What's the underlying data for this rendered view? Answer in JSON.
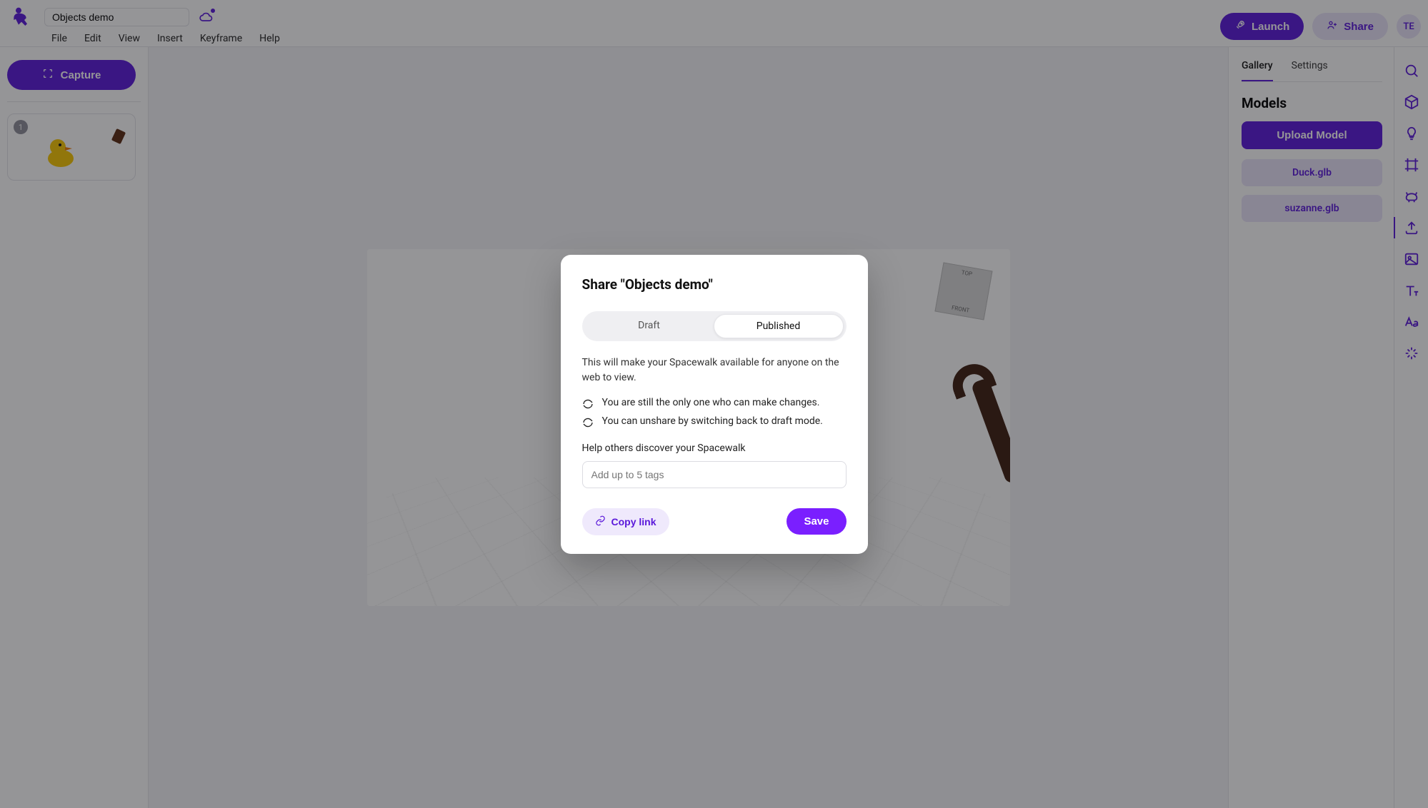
{
  "header": {
    "project_name": "Objects demo",
    "menu": [
      "File",
      "Edit",
      "View",
      "Insert",
      "Keyframe",
      "Help"
    ],
    "launch_label": "Launch",
    "share_label": "Share",
    "user_initials": "TE"
  },
  "left": {
    "capture_label": "Capture",
    "scene_badge": "1"
  },
  "right": {
    "tabs": {
      "gallery": "Gallery",
      "settings": "Settings"
    },
    "section_title": "Models",
    "upload_label": "Upload Model",
    "models": [
      "Duck.glb",
      "suzanne.glb"
    ]
  },
  "tools": [
    "search-icon",
    "cube-icon",
    "lightbulb-icon",
    "frame-icon",
    "animal-icon",
    "upload-icon",
    "image-icon",
    "text-style-icon",
    "typography-icon",
    "sparkle-icon"
  ],
  "modal": {
    "title": "Share \"Objects demo\"",
    "seg_draft": "Draft",
    "seg_published": "Published",
    "description": "This will make your Spacewalk available for anyone on the web to view.",
    "bullet1": "You are still the only one who can make changes.",
    "bullet2": "You can unshare by switching back to draft mode.",
    "subheading": "Help others discover your Spacewalk",
    "tags_placeholder": "Add up to 5 tags",
    "copy_label": "Copy link",
    "save_label": "Save"
  },
  "nav_cube": {
    "top": "TOP",
    "front": "FRONT"
  }
}
